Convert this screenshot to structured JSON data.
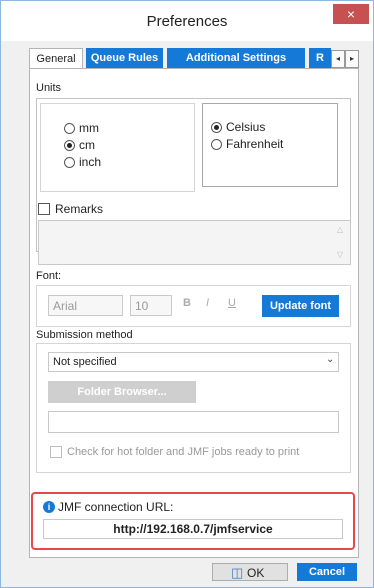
{
  "window": {
    "title": "Preferences",
    "close_glyph": "×"
  },
  "tabs": [
    {
      "label": "General"
    },
    {
      "label": "Queue Rules"
    },
    {
      "label": "Additional Settings"
    },
    {
      "label": "R"
    }
  ],
  "tab_arrows": {
    "left": "◂",
    "right": "▸"
  },
  "units": {
    "heading": "Units",
    "length": [
      {
        "label": "mm",
        "selected": false
      },
      {
        "label": "cm",
        "selected": true
      },
      {
        "label": "inch",
        "selected": false
      }
    ],
    "temperature": [
      {
        "label": "Celsius",
        "selected": true
      },
      {
        "label": "Fahrenheit",
        "selected": false
      }
    ]
  },
  "remarks": {
    "label": "Remarks",
    "checked": false,
    "value": ""
  },
  "font": {
    "heading": "Font:",
    "family_value": "Arial",
    "size_value": "10",
    "bold": "B",
    "italic": "I",
    "underline": "U",
    "update_button": "Update font"
  },
  "submission": {
    "heading": "Submission method",
    "method_value": "Not specified",
    "folder_button": "Folder Browser...",
    "folder_value": "",
    "hotfolder_check_label": "Check for hot folder and JMF jobs ready to print"
  },
  "jmf": {
    "label": "JMF connection URL:",
    "url": "http://192.168.0.7/jmfservice",
    "info_glyph": "i"
  },
  "footer": {
    "ok_label": "OK",
    "cancel_label": "Cancel"
  },
  "colors": {
    "accent_blue": "#1579d8",
    "highlight_red": "#e9474a",
    "close_red": "#c75050"
  }
}
